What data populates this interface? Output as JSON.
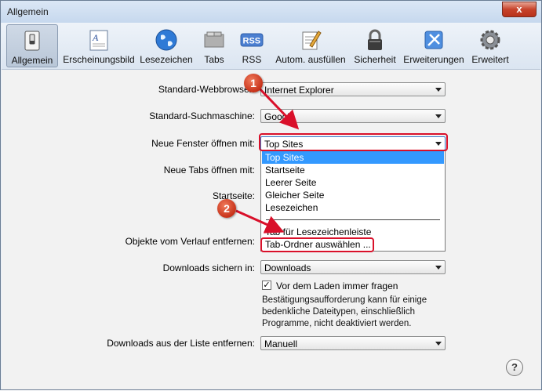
{
  "window": {
    "title": "Allgemein",
    "close_label": "x"
  },
  "toolbar": {
    "items": [
      {
        "label": "Allgemein",
        "icon": "switch-icon"
      },
      {
        "label": "Erscheinungsbild",
        "icon": "font-icon"
      },
      {
        "label": "Lesezeichen",
        "icon": "globe-icon"
      },
      {
        "label": "Tabs",
        "icon": "tabs-icon"
      },
      {
        "label": "RSS",
        "icon": "rss-icon"
      },
      {
        "label": "Autom. ausfüllen",
        "icon": "pencil-form-icon"
      },
      {
        "label": "Sicherheit",
        "icon": "lock-icon"
      },
      {
        "label": "Erweiterungen",
        "icon": "extensions-icon"
      },
      {
        "label": "Erweitert",
        "icon": "gear-icon"
      }
    ],
    "rss_text": "RSS"
  },
  "form": {
    "default_browser_label": "Standard-Webbrowser:",
    "default_browser_value": "Internet Explorer",
    "search_engine_label": "Standard-Suchmaschine:",
    "search_engine_value": "Google",
    "new_window_label": "Neue Fenster öffnen mit:",
    "new_window_value": "Top Sites",
    "new_tabs_label": "Neue Tabs öffnen mit:",
    "homepage_label": "Startseite:",
    "history_label": "Objekte vom Verlauf entfernen:",
    "downloads_save_label": "Downloads sichern in:",
    "downloads_save_value": "Downloads",
    "ask_before_download": "Vor dem Laden immer fragen",
    "ask_note": "Bestätigungsaufforderung kann für einige bedenkliche Dateitypen, einschließlich Programme, nicht deaktiviert werden.",
    "downloads_remove_label": "Downloads aus der Liste entfernen:",
    "downloads_remove_value": "Manuell"
  },
  "dropdown_options": [
    "Top Sites",
    "Startseite",
    "Leerer Seite",
    "Gleicher Seite",
    "Lesezeichen",
    "Tab für Lesezeichenleiste",
    "Tab-Ordner auswählen ..."
  ],
  "annotations": {
    "badge1": "1",
    "badge2": "2"
  },
  "help_label": "?",
  "colors": {
    "highlight": "#d9102a",
    "selection": "#3399ff"
  }
}
